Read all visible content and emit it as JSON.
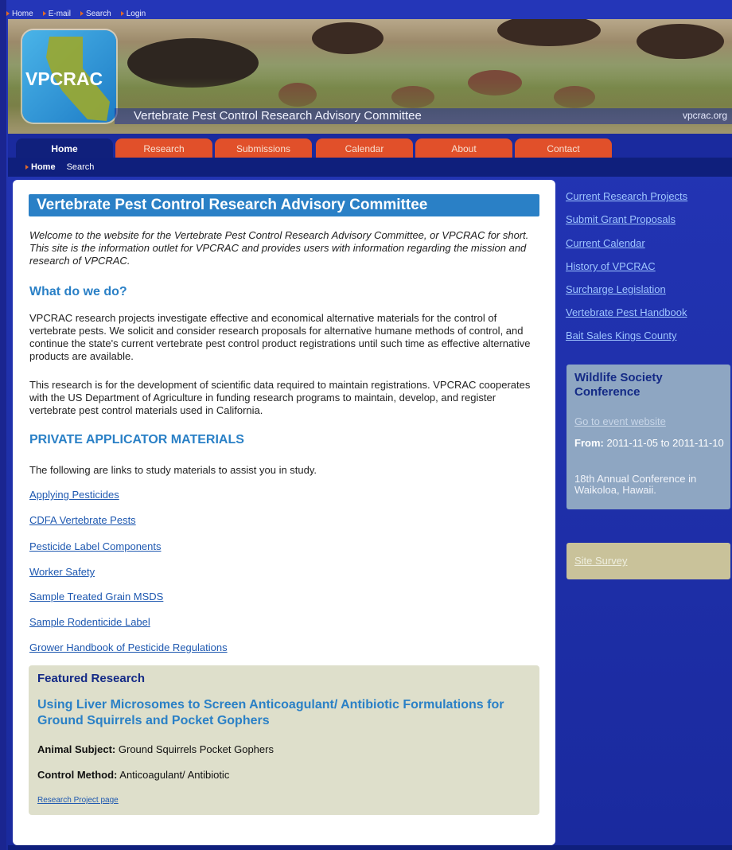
{
  "topbar": {
    "links": [
      "Home",
      "E-mail",
      "Search",
      "Login"
    ]
  },
  "banner": {
    "logo_text": "VPCRAC",
    "title": "Vertebrate Pest Control Research Advisory Committee",
    "url": "vpcrac.org"
  },
  "tabs": [
    "Home",
    "Research",
    "Submissions",
    "Calendar",
    "About",
    "Contact"
  ],
  "subnav": {
    "items": [
      "Home",
      "Search"
    ]
  },
  "main": {
    "title": "Vertebrate Pest Control Research Advisory Committee",
    "intro": "Welcome to the website for the Vertebrate Pest Control Research Advisory Committee, or VPCRAC for short. This site is the information outlet for VPCRAC and provides users with information regarding the mission and research of VPCRAC.",
    "what_heading": "What do we do?",
    "what_p1": "VPCRAC research projects investigate effective and economical alternative materials for the control of vertebrate pests. We solicit and consider research proposals for alternative humane methods of control, and continue the state's current vertebrate pest control product registrations until such time as effective alternative products are available.",
    "what_p2": "This research is for the development of scientific data required to maintain registrations. VPCRAC cooperates with the US Department of Agriculture in funding research programs to maintain, develop, and register vertebrate pest control materials used in California.",
    "pam_heading": "PRIVATE APPLICATOR MATERIALS",
    "pam_intro": "The following are links to study materials to assist you in study.",
    "links": [
      "Applying Pesticides",
      "CDFA Vertebrate Pests",
      "Pesticide Label Components",
      "Worker Safety",
      "Sample Treated Grain MSDS",
      "Sample Rodenticide Label",
      "Grower Handbook of Pesticide Regulations"
    ],
    "featured": {
      "heading": "Featured Research",
      "title": "Using Liver Microsomes to Screen Anticoagulant/ Antibiotic Formulations for Ground Squirrels and Pocket Gophers",
      "animal_label": "Animal Subject:",
      "animal_value": "Ground Squirrels Pocket Gophers",
      "control_label": "Control Method:",
      "control_value": "Anticoagulant/ Antibiotic",
      "project_link": "Research Project page"
    }
  },
  "sidebar": {
    "links": [
      "Current Research Projects",
      "Submit Grant Proposals",
      "Current Calendar",
      "History of VPCRAC",
      "Surcharge Legislation",
      "Vertebrate Pest Handbook",
      "Bait Sales Kings County"
    ],
    "event": {
      "title": "Wildlife Society Conference",
      "link": "Go to event website",
      "from_label": "From:",
      "from_value": "2011-11-05 to 2011-11-10",
      "desc": "18th Annual Conference in Waikoloa, Hawaii."
    },
    "survey": "Site Survey"
  }
}
